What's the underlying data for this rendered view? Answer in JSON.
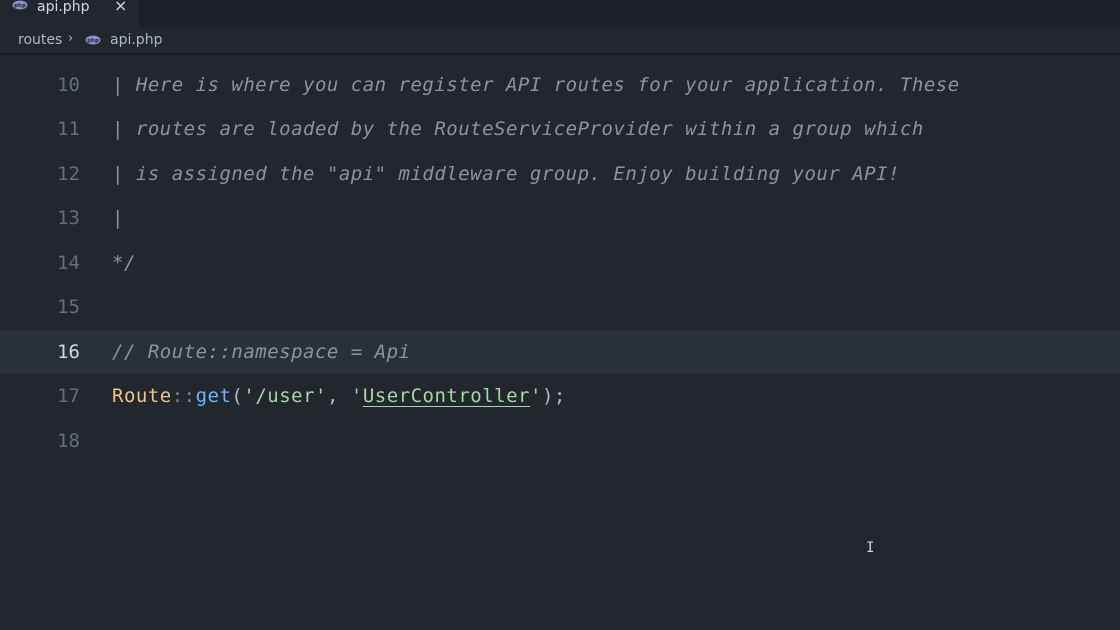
{
  "tab": {
    "label": "api.php",
    "close_symbol": "×",
    "icon": "php-file-icon"
  },
  "breadcrumb": {
    "folder": "routes",
    "separator": "›",
    "file": "api.php",
    "file_icon": "php-file-icon"
  },
  "editor": {
    "active_line": 16,
    "lines": [
      {
        "number": "10",
        "text": "| Here is where you can register API routes for your application. These"
      },
      {
        "number": "11",
        "text": "| routes are loaded by the RouteServiceProvider within a group which"
      },
      {
        "number": "12",
        "text": "| is assigned the \"api\" middleware group. Enjoy building your API!"
      },
      {
        "number": "13",
        "text": "|"
      },
      {
        "number": "14",
        "text": "*/"
      },
      {
        "number": "15",
        "text": ""
      },
      {
        "number": "16",
        "text": "// Route::namespace = Api"
      },
      {
        "number": "17",
        "tokens": {
          "class": "Route",
          "op": "::",
          "method": "get",
          "open": "(",
          "q1": "'",
          "path": "/user",
          "q2": "'",
          "comma": ", ",
          "q3": "'",
          "controller": "UserController",
          "q4": "'",
          "close": ");"
        }
      },
      {
        "number": "18",
        "text": ""
      }
    ]
  },
  "mouse_cursor": "I",
  "colors": {
    "background": "#22272e",
    "tabbar": "#1c2128",
    "active_line": "#2a3038",
    "comment": "#8b949e",
    "class": "#f0c389",
    "function": "#6cb6ff",
    "string": "#a5d6a7",
    "line_number": "#636e7b"
  }
}
